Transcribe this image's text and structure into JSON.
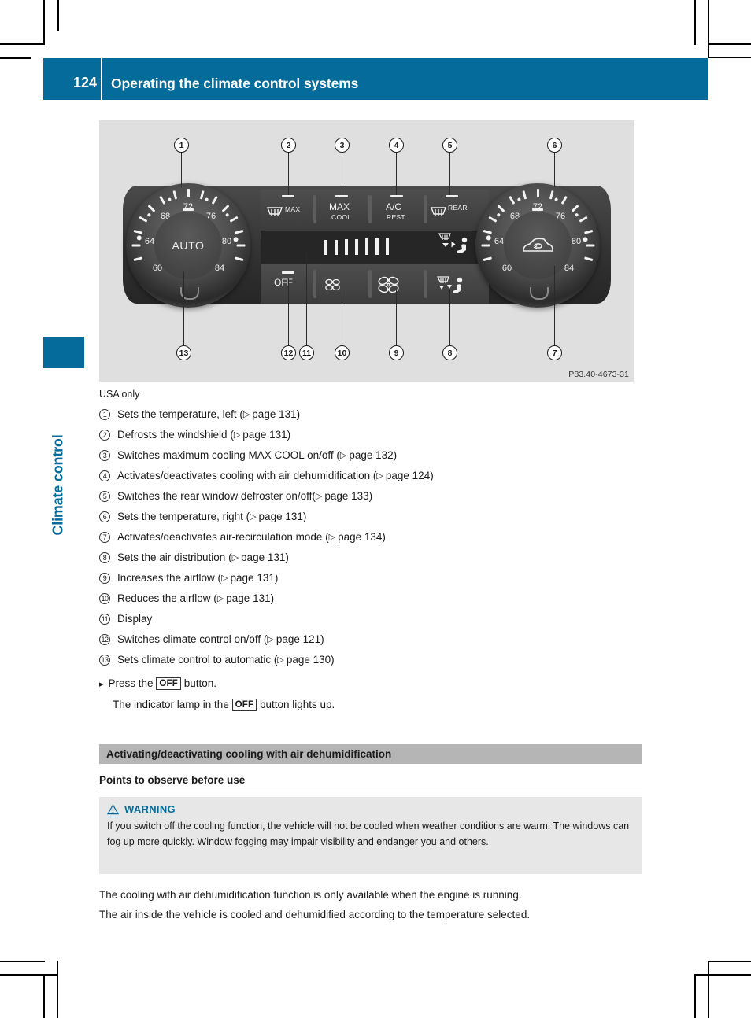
{
  "header": {
    "page_number": "124",
    "title": "Operating the climate control systems",
    "accent_color": "#046b9b"
  },
  "chapter_tab": {
    "label": "Climate control"
  },
  "figure": {
    "caption_code": "P83.40-4673-31",
    "knob_left": {
      "center_label": "AUTO",
      "scale": [
        "60",
        "64",
        "68",
        "72",
        "76",
        "80",
        "84"
      ]
    },
    "knob_right": {
      "center_label": "recirculation-car-icon",
      "scale": [
        "60",
        "64",
        "68",
        "72",
        "76",
        "80",
        "84"
      ]
    },
    "buttons_top": [
      {
        "id": "defrost-max",
        "label": "MAX",
        "icon": "windshield-defrost-icon"
      },
      {
        "id": "max-cool",
        "label": "MAX",
        "sublabel": "COOL"
      },
      {
        "id": "ac-rest",
        "label": "A/C",
        "sublabel": "REST"
      },
      {
        "id": "rear-defrost",
        "label": "REAR",
        "icon": "rear-window-defrost-icon"
      }
    ],
    "buttons_bottom": [
      {
        "id": "off",
        "label": "OFF"
      },
      {
        "id": "fan-decrease",
        "label": "",
        "icon": "fan-small-icon"
      },
      {
        "id": "fan-increase",
        "label": "",
        "icon": "fan-large-icon"
      },
      {
        "id": "air-distribution",
        "label": "",
        "icon": "air-distribution-icon"
      }
    ],
    "callouts": [
      "1",
      "2",
      "3",
      "4",
      "5",
      "6",
      "7",
      "8",
      "9",
      "10",
      "11",
      "12",
      "13"
    ]
  },
  "body": {
    "usa_only": "USA only",
    "items": [
      {
        "num": "1",
        "text": "Sets the temperature, left (",
        "ref": "page 131",
        "tail": ")"
      },
      {
        "num": "2",
        "text": "Defrosts the windshield (",
        "ref": "page 131",
        "tail": ")"
      },
      {
        "num": "3",
        "text": "Switches maximum cooling MAX COOL on/off (",
        "ref": "page 132",
        "tail": ")"
      },
      {
        "num": "4",
        "text": "Activates/deactivates cooling with air dehumidification (",
        "ref": "page 124",
        "tail": ")"
      },
      {
        "num": "5",
        "text": "Switches the rear window defroster on/off(",
        "ref": "page 133",
        "tail": ")"
      },
      {
        "num": "6",
        "text": "Sets the temperature, right (",
        "ref": "page 131",
        "tail": ")"
      },
      {
        "num": "7",
        "text": "Activates/deactivates air-recirculation mode (",
        "ref": "page 134",
        "tail": ")"
      },
      {
        "num": "8",
        "text": "Sets the air distribution (",
        "ref": "page 131",
        "tail": ")"
      },
      {
        "num": "9",
        "text": "Increases the airflow (",
        "ref": "page 131",
        "tail": ")"
      },
      {
        "num": "10",
        "text": "Reduces the airflow (",
        "ref": "page 131",
        "tail": ")"
      },
      {
        "num": "11",
        "text": "Display",
        "ref": "",
        "tail": ""
      },
      {
        "num": "12",
        "text": "Switches climate control on/off (",
        "ref": "page 121",
        "tail": ")"
      },
      {
        "num": "13",
        "text": "Sets climate control to automatic (",
        "ref": "page 130",
        "tail": ")"
      }
    ],
    "step": {
      "lead": "Press the",
      "key": "OFF",
      "lead_end": "button.",
      "result_start": "The indicator lamp in the",
      "result_key": "OFF",
      "result_end": "button lights up."
    },
    "gray_heading": "Activating/deactivating cooling with air dehumidification",
    "sub_heading": "Points to observe before use",
    "warning": {
      "title": "WARNING",
      "text": "If you switch off the cooling function, the vehicle will not be cooled when weather conditions are warm. The windows can fog up more quickly. Window fogging may impair visibility and endanger you and others.",
      "title_color": "#046b9b"
    },
    "paragraphs": [
      "The cooling with air dehumidification function is only available when the engine is running.",
      "The air inside the vehicle is cooled and dehumidified according to the temperature selected."
    ]
  }
}
